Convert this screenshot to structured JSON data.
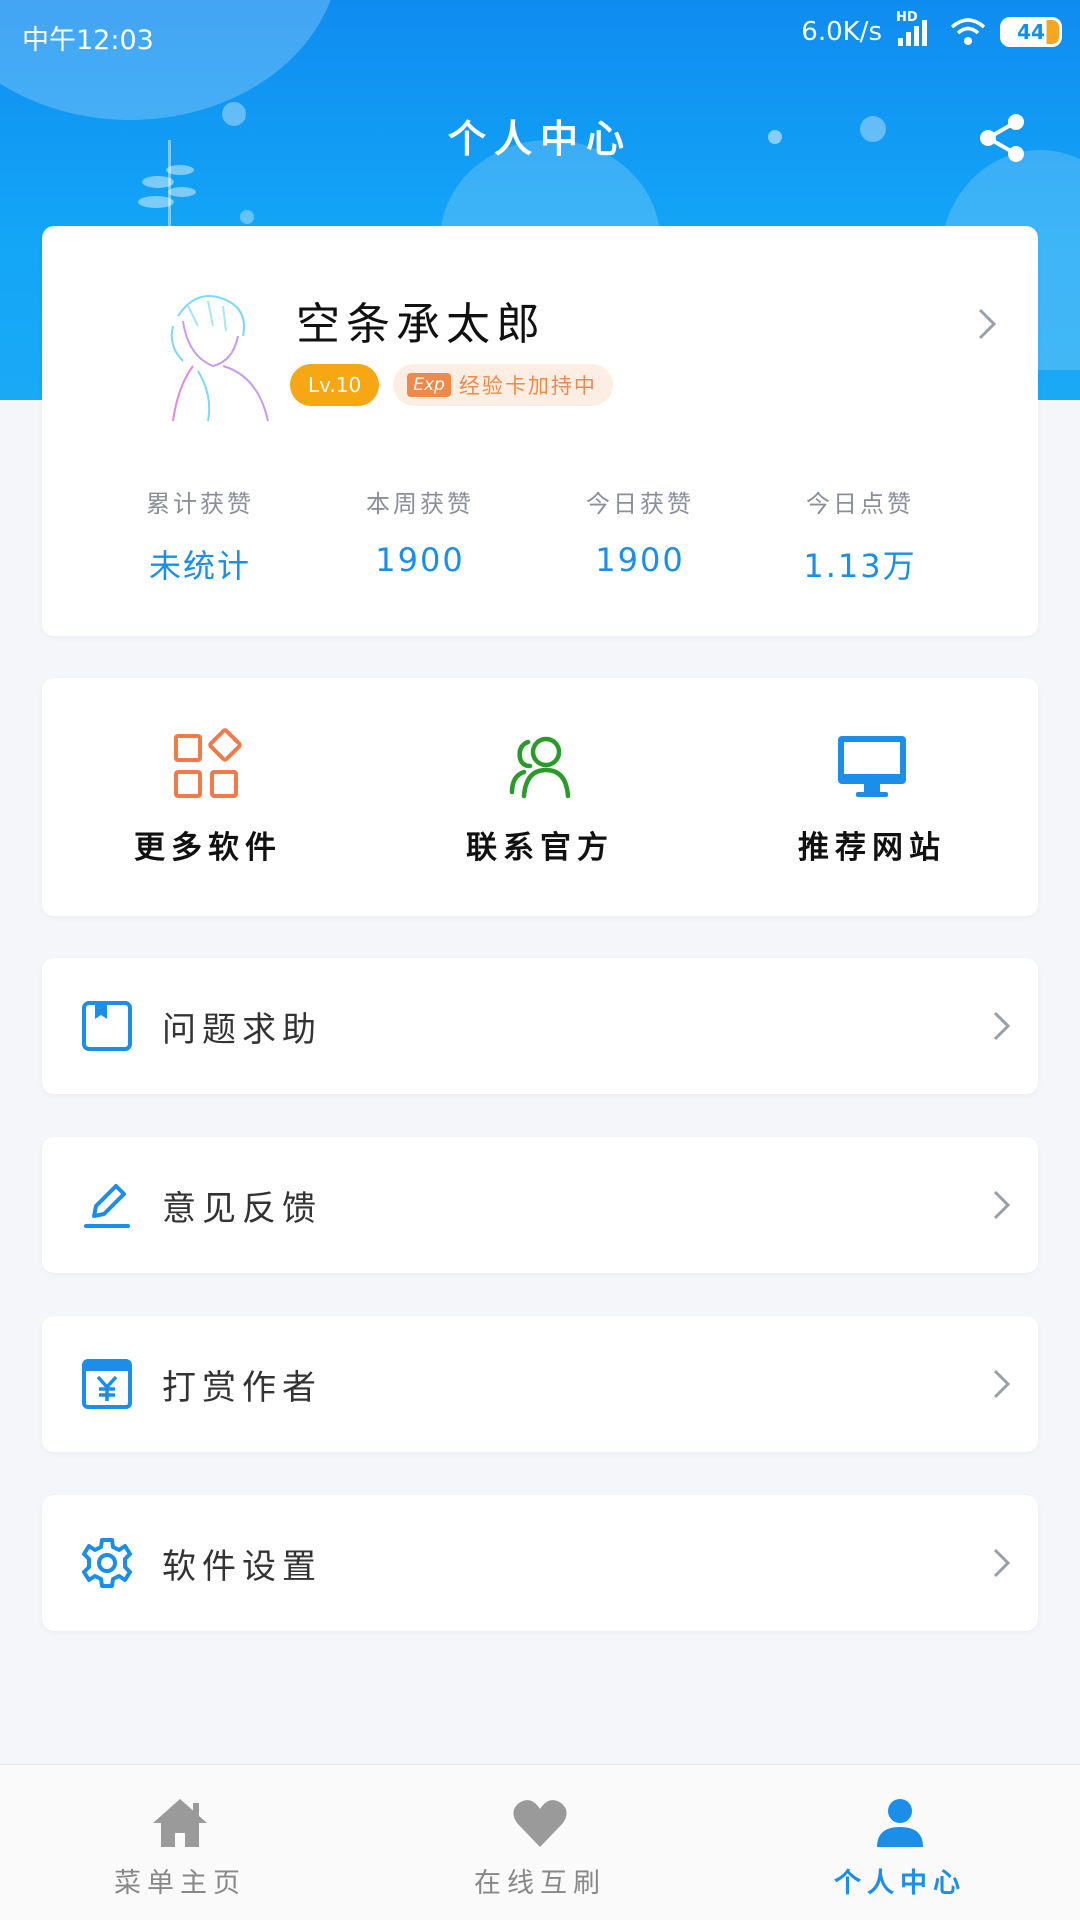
{
  "status_bar": {
    "time": "中午12:03",
    "network_speed": "6.0K/s",
    "network_badge": "HD",
    "battery": "44",
    "icons": [
      "signal-icon",
      "wifi-icon",
      "battery-icon"
    ]
  },
  "header": {
    "title": "个人中心",
    "share_icon": "share-icon"
  },
  "profile": {
    "username": "空条承太郎",
    "level": "Lv.10",
    "exp_tag": "Exp",
    "exp_text": "经验卡加持中",
    "stats": [
      {
        "label": "累计获赞",
        "value": "未统计"
      },
      {
        "label": "本周获赞",
        "value": "1900"
      },
      {
        "label": "今日获赞",
        "value": "1900"
      },
      {
        "label": "今日点赞",
        "value": "1.13万"
      }
    ]
  },
  "quick_actions": [
    {
      "label": "更多软件",
      "icon": "apps-icon",
      "color": "#f07a4a"
    },
    {
      "label": "联系官方",
      "icon": "contacts-icon",
      "color": "#2a9a2a"
    },
    {
      "label": "推荐网站",
      "icon": "monitor-icon",
      "color": "#1a8ee9"
    }
  ],
  "menu": [
    {
      "label": "问题求助",
      "icon": "help-book-icon"
    },
    {
      "label": "意见反馈",
      "icon": "edit-icon"
    },
    {
      "label": "打赏作者",
      "icon": "reward-yen-icon"
    },
    {
      "label": "软件设置",
      "icon": "gear-icon"
    }
  ],
  "bottom_nav": [
    {
      "label": "菜单主页",
      "icon": "home-icon",
      "active": false
    },
    {
      "label": "在线互刷",
      "icon": "heart-icon",
      "active": false
    },
    {
      "label": "个人中心",
      "icon": "person-icon",
      "active": true
    }
  ],
  "colors": {
    "header_blue": "#0f8cf0",
    "accent_blue": "#1a8ee9",
    "level_orange": "#f7a614",
    "exp_orange": "#f08a4b"
  }
}
